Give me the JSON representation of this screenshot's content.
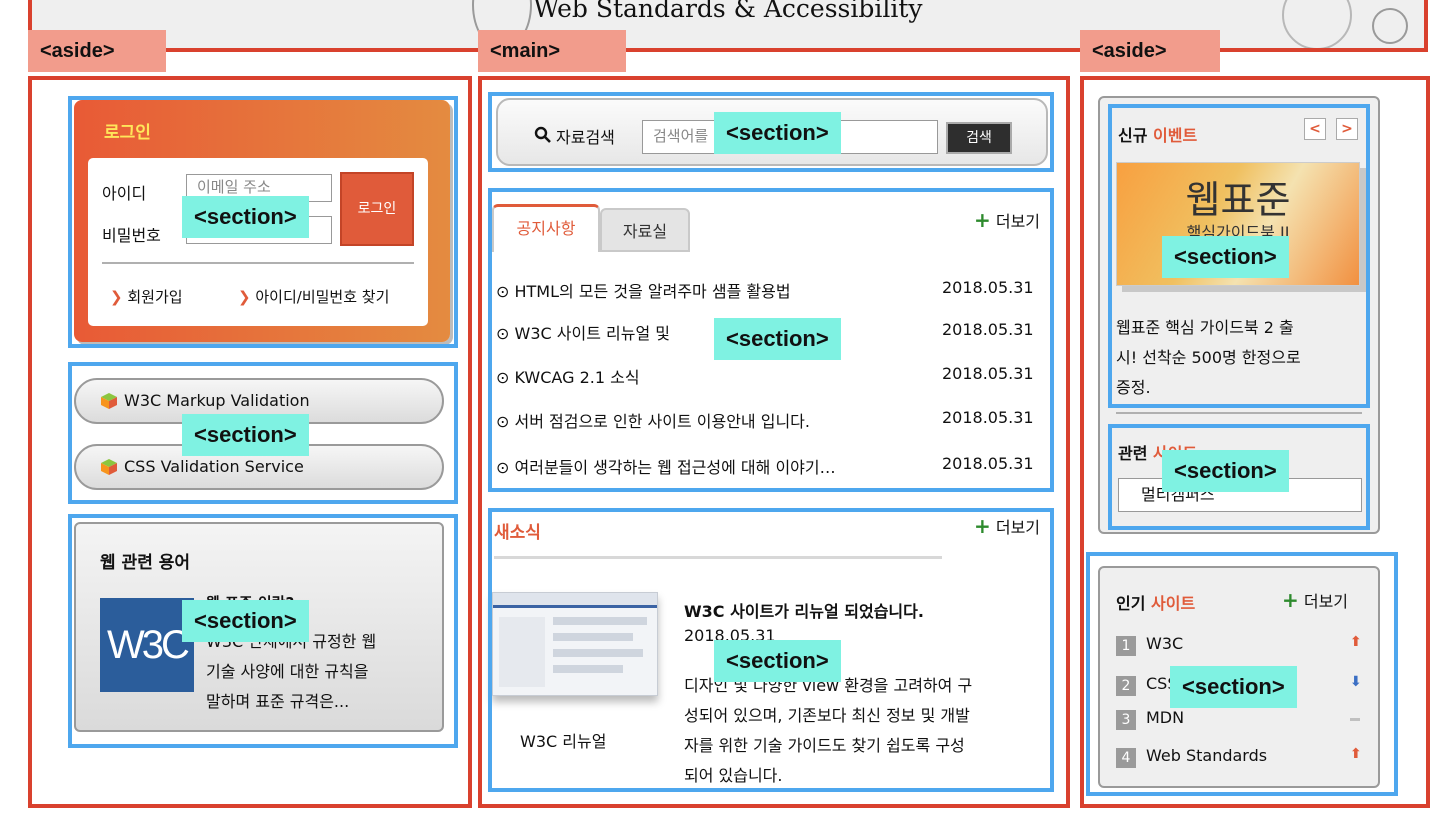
{
  "header": {
    "title": "Web Standards & Accessibility"
  },
  "tags": {
    "left_aside": "<aside>",
    "main": "<main>",
    "right_aside": "<aside>",
    "section": "<section>"
  },
  "login": {
    "title": "로그인",
    "id_label": "아이디",
    "pw_label": "비밀번호",
    "id_placeholder": "이메일 주소",
    "button": "로그인",
    "signup": "회원가입",
    "find": "아이디/비밀번호 찾기"
  },
  "validators": [
    {
      "label": "W3C Markup Validation"
    },
    {
      "label": "CSS Validation Service"
    }
  ],
  "glossary": {
    "title": "웹 관련 용어",
    "logo_text": "W3C",
    "term": "웹 표준 이란?",
    "line1": "W3C 단체에서 규정한 웹",
    "line2": "기술 사양에 대한 규칙을",
    "line3": "말하며 표준 규격은..."
  },
  "search": {
    "label": "자료검색",
    "placeholder": "검색어를 입력하세요",
    "button": "검색"
  },
  "notice": {
    "tabs": [
      "공지사항",
      "자료실"
    ],
    "more": "더보기",
    "items": [
      {
        "title": "HTML의 모든 것을 알려주마 샘플 활용법",
        "date": "2018.05.31"
      },
      {
        "title": "W3C 사이트 리뉴얼 및",
        "date": "2018.05.31"
      },
      {
        "title": "KWCAG 2.1 소식",
        "date": "2018.05.31"
      },
      {
        "title": "서버 점검으로 인한 사이트 이용안내 입니다.",
        "date": "2018.05.31"
      },
      {
        "title": "여러분들이 생각하는 웹 접근성에 대해 이야기…",
        "date": "2018.05.31"
      }
    ]
  },
  "news": {
    "title": "새소식",
    "more": "더보기",
    "caption": "W3C 리뉴얼",
    "headline": "W3C 사이트가 리뉴얼 되었습니다.",
    "date": "2018.05.31",
    "line1": "디자인 및 다양한 view 환경을 고려하여 구",
    "line2": "성되어 있으며, 기존보다 최신 정보 및 개발",
    "line3": "자를 위한 기술 가이드도 찾기 쉽도록 구성",
    "line4": "되어 있습니다."
  },
  "event": {
    "title_a": "신규",
    "title_b": "이벤트",
    "prev": "<",
    "next": ">",
    "img_title": "웹표준",
    "img_sub": "핵심가이드북 II",
    "desc1": "웹표준 핵심 가이드북 2 출",
    "desc2": "시! 선착순 500명 한정으로",
    "desc3": "증정."
  },
  "related": {
    "title_a": "관련",
    "title_b": "사이트",
    "select": "멀티캠퍼스"
  },
  "popular": {
    "title_a": "인기",
    "title_b": "사이트",
    "more": "더보기",
    "items": [
      {
        "rank": "1",
        "name": "W3C",
        "trend": "up"
      },
      {
        "rank": "2",
        "name": "CSS",
        "trend": "down"
      },
      {
        "rank": "3",
        "name": "MDN",
        "trend": "same"
      },
      {
        "rank": "4",
        "name": "Web Standards",
        "trend": "up"
      }
    ]
  },
  "colors": {
    "frame": "#d9412e",
    "section": "#4ea7ee",
    "accent": "#e05b3a"
  }
}
